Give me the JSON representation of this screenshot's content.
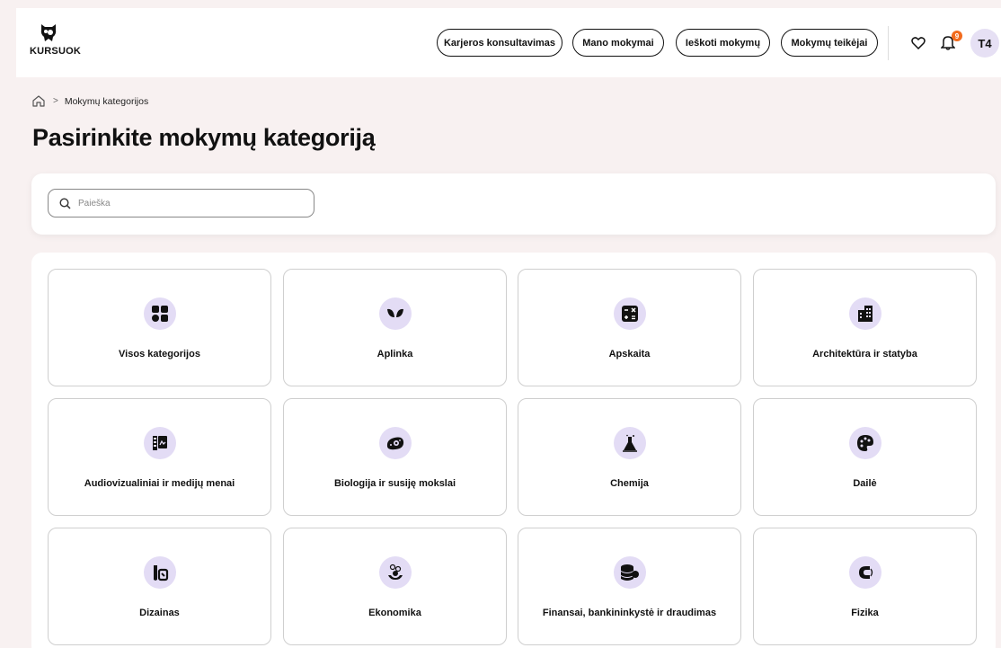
{
  "header": {
    "logo_text": "KURSUOK",
    "nav": [
      {
        "label": "Karjeros konsultavimas"
      },
      {
        "label": "Mano mokymai"
      },
      {
        "label": "Ieškoti mokymų"
      },
      {
        "label": "Mokymų teikėjai"
      }
    ],
    "notifications_count": "9",
    "avatar_initials": "T4"
  },
  "breadcrumb": {
    "home_icon": "home-icon",
    "current": "Mokymų kategorijos"
  },
  "page_title": "Pasirinkite mokymų kategoriją",
  "search": {
    "placeholder": "Paieška",
    "value": ""
  },
  "categories": [
    {
      "label": "Visos kategorijos",
      "icon": "grid-icon"
    },
    {
      "label": "Aplinka",
      "icon": "leaves-icon"
    },
    {
      "label": "Apskaita",
      "icon": "calculator-icon"
    },
    {
      "label": "Architektūra ir statyba",
      "icon": "buildings-icon"
    },
    {
      "label": "Audiovizualiniai ir medijų menai",
      "icon": "media-icon"
    },
    {
      "label": "Biologija ir susiję mokslai",
      "icon": "cell-icon"
    },
    {
      "label": "Chemija",
      "icon": "flask-icon"
    },
    {
      "label": "Dailė",
      "icon": "palette-icon"
    },
    {
      "label": "Dizainas",
      "icon": "design-icon"
    },
    {
      "label": "Ekonomika",
      "icon": "economy-icon"
    },
    {
      "label": "Finansai, bankininkystė ir draudimas",
      "icon": "coins-icon"
    },
    {
      "label": "Fizika",
      "icon": "magnet-icon"
    }
  ],
  "colors": {
    "background": "#f8f1f1",
    "icon_bg": "#e3dcf5",
    "badge": "#f26b1d",
    "avatar_bg": "#e6e0f4"
  }
}
